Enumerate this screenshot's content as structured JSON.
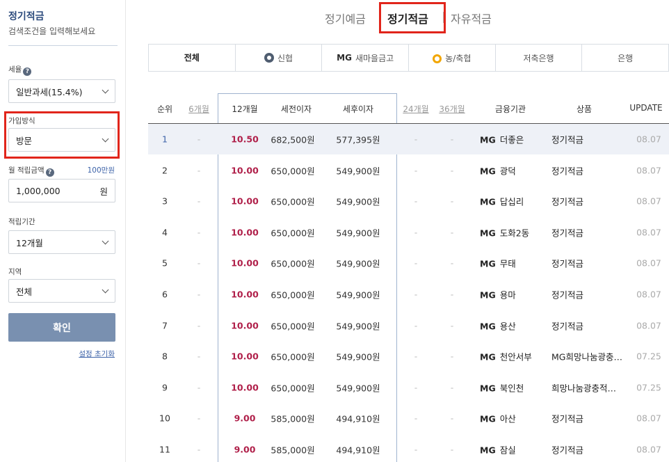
{
  "sidebar": {
    "title": "정기적금",
    "subtitle": "검색조건을 입력해보세요",
    "tax": {
      "label": "세율",
      "value": "일반과세(15.4%)"
    },
    "method": {
      "label": "가입방식",
      "value": "방문"
    },
    "monthly": {
      "label": "월 적립금액",
      "unit_note": "100만원",
      "value": "1,000,000",
      "unit": "원"
    },
    "period": {
      "label": "적립기간",
      "value": "12개월"
    },
    "region": {
      "label": "지역",
      "value": "전체"
    },
    "confirm_label": "확인",
    "reset_label": "설정 초기화"
  },
  "categories": [
    "정기예금",
    "정기적금",
    "자유적금"
  ],
  "institution_tabs": [
    {
      "label": "전체",
      "icon": ""
    },
    {
      "label": "신협",
      "icon": "credit-union-icon"
    },
    {
      "label": "새마을금고",
      "prefix": "MG",
      "icon": "mg-logo"
    },
    {
      "label": "농/축협",
      "icon": "nh-logo-icon"
    },
    {
      "label": "저축은행",
      "icon": ""
    },
    {
      "label": "은행",
      "icon": ""
    }
  ],
  "table": {
    "headers": {
      "rank": "순위",
      "m6": "6개월",
      "m12": "12개월",
      "pre_tax": "세전이자",
      "post_tax": "세후이자",
      "m24": "24개월",
      "m36": "36개월",
      "institution": "금융기관",
      "product": "상품",
      "update": "UPDATE"
    },
    "rows": [
      {
        "rank": "1",
        "m6": "-",
        "rate": "10.50",
        "pre": "682,500원",
        "post": "577,395원",
        "m24": "-",
        "m36": "-",
        "inst_prefix": "MG",
        "inst": "더좋은",
        "product": "정기적금",
        "update": "08.07"
      },
      {
        "rank": "2",
        "m6": "-",
        "rate": "10.00",
        "pre": "650,000원",
        "post": "549,900원",
        "m24": "-",
        "m36": "-",
        "inst_prefix": "MG",
        "inst": "광덕",
        "product": "정기적금",
        "update": "08.07"
      },
      {
        "rank": "3",
        "m6": "-",
        "rate": "10.00",
        "pre": "650,000원",
        "post": "549,900원",
        "m24": "-",
        "m36": "-",
        "inst_prefix": "MG",
        "inst": "답십리",
        "product": "정기적금",
        "update": "08.07"
      },
      {
        "rank": "4",
        "m6": "-",
        "rate": "10.00",
        "pre": "650,000원",
        "post": "549,900원",
        "m24": "-",
        "m36": "-",
        "inst_prefix": "MG",
        "inst": "도화2동",
        "product": "정기적금",
        "update": "08.07"
      },
      {
        "rank": "5",
        "m6": "-",
        "rate": "10.00",
        "pre": "650,000원",
        "post": "549,900원",
        "m24": "-",
        "m36": "-",
        "inst_prefix": "MG",
        "inst": "무태",
        "product": "정기적금",
        "update": "08.07"
      },
      {
        "rank": "6",
        "m6": "-",
        "rate": "10.00",
        "pre": "650,000원",
        "post": "549,900원",
        "m24": "-",
        "m36": "-",
        "inst_prefix": "MG",
        "inst": "용마",
        "product": "정기적금",
        "update": "08.07"
      },
      {
        "rank": "7",
        "m6": "-",
        "rate": "10.00",
        "pre": "650,000원",
        "post": "549,900원",
        "m24": "-",
        "m36": "-",
        "inst_prefix": "MG",
        "inst": "용산",
        "product": "정기적금",
        "update": "08.07"
      },
      {
        "rank": "8",
        "m6": "-",
        "rate": "10.00",
        "pre": "650,000원",
        "post": "549,900원",
        "m24": "-",
        "m36": "-",
        "inst_prefix": "MG",
        "inst": "천안서부",
        "product": "MG희망나눔광충…",
        "update": "07.25"
      },
      {
        "rank": "9",
        "m6": "-",
        "rate": "10.00",
        "pre": "650,000원",
        "post": "549,900원",
        "m24": "-",
        "m36": "-",
        "inst_prefix": "MG",
        "inst": "북인천",
        "product": "희망나눔광충적…",
        "update": "07.25"
      },
      {
        "rank": "10",
        "m6": "-",
        "rate": "9.00",
        "pre": "585,000원",
        "post": "494,910원",
        "m24": "-",
        "m36": "-",
        "inst_prefix": "MG",
        "inst": "아산",
        "product": "정기적금",
        "update": "08.07"
      },
      {
        "rank": "11",
        "m6": "-",
        "rate": "9.00",
        "pre": "585,000원",
        "post": "494,910원",
        "m24": "-",
        "m36": "-",
        "inst_prefix": "MG",
        "inst": "잠실",
        "product": "정기적금",
        "update": "08.07"
      }
    ]
  },
  "colors": {
    "accent": "#2b4a7c",
    "highlight_border": "#e1251b",
    "rate": "#b0204a",
    "button": "#7990b0"
  }
}
